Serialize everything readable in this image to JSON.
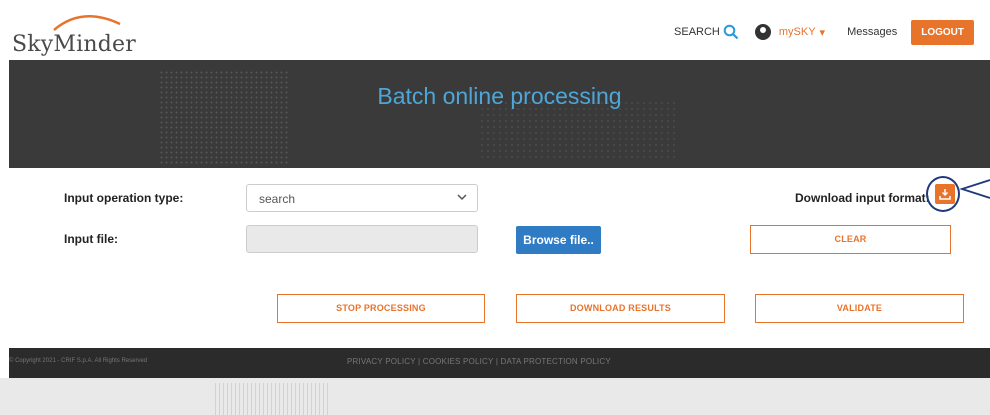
{
  "header": {
    "logo_text": "SkyMinder",
    "search_label": "SEARCH",
    "mysky_label": "mySKY",
    "mysky_caret": "▾",
    "messages_label": "Messages",
    "logout_label": "LOGOUT"
  },
  "banner": {
    "title": "Batch online processing"
  },
  "form": {
    "operation_type_label": "Input operation type:",
    "operation_type_value": "search",
    "input_file_label": "Input file:",
    "browse_label": "Browse file..",
    "download_format_label": "Download input format:",
    "clear_label": "CLEAR"
  },
  "actions": {
    "stop_label": "STOP PROCESSING",
    "download_results_label": "DOWNLOAD RESULTS",
    "validate_label": "VALIDATE"
  },
  "footer": {
    "copyright": "© Copyright 2021 - CRIF S.p.A. All Rights Reserved",
    "links": "PRIVACY POLICY  |  COOKIES POLICY  |  DATA PROTECTION POLICY"
  },
  "colors": {
    "accent": "#e8732b",
    "title_blue": "#4ea6d8",
    "browse_blue": "#2f7cc4",
    "banner_bg": "#3a3a3a"
  },
  "icons": [
    "search-icon",
    "user-icon",
    "download-icon",
    "chevron-down-icon"
  ]
}
